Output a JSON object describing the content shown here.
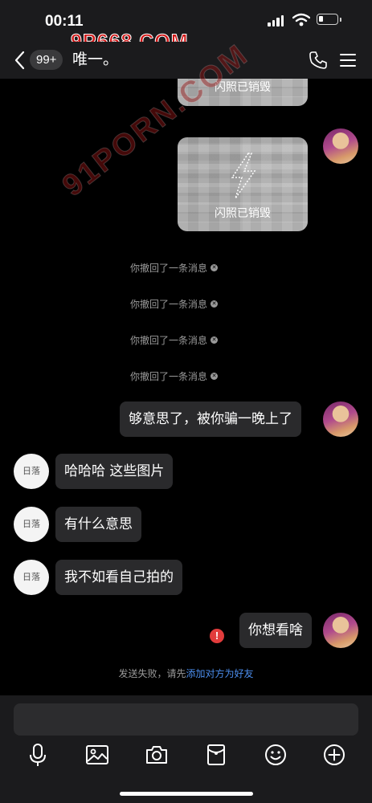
{
  "status_bar": {
    "time": "00:11",
    "signal_icon": "signal-icon",
    "wifi_icon": "wifi-icon",
    "battery_icon": "battery-icon",
    "battery_level": 0.25
  },
  "watermarks": {
    "top": "9P668.COM",
    "diagonal": "91PORN.COM"
  },
  "header": {
    "back_icon": "chevron-left-icon",
    "unread_badge": "99+",
    "contact_name": "唯一。",
    "call_icon": "phone-icon",
    "menu_icon": "menu-icon"
  },
  "messages": {
    "flash_1": {
      "label": "闪照已销毁"
    },
    "flash_2": {
      "label": "闪照已销毁"
    },
    "recalls": [
      "你撤回了一条消息",
      "你撤回了一条消息",
      "你撤回了一条消息",
      "你撤回了一条消息"
    ],
    "me_1": "够意思了，被你骗一晚上了",
    "them_1": "哈哈哈 这些图片",
    "them_2": "有什么意思",
    "them_3": "我不如看自己拍的",
    "me_2": "你想看啥",
    "error_mark": "!",
    "fail_prefix": "发送失败，请先",
    "fail_link": "添加对方为好友",
    "their_avatar_text": "日落"
  },
  "toolbar": {
    "icons": [
      "microphone-icon",
      "image-icon",
      "camera-icon",
      "red-packet-icon",
      "emoji-icon",
      "plus-icon"
    ]
  },
  "colors": {
    "background": "#000000",
    "bar": "#1b1b1d",
    "bubble": "#2a2a2c",
    "link": "#4c8ff0",
    "error": "#e23c3c"
  }
}
